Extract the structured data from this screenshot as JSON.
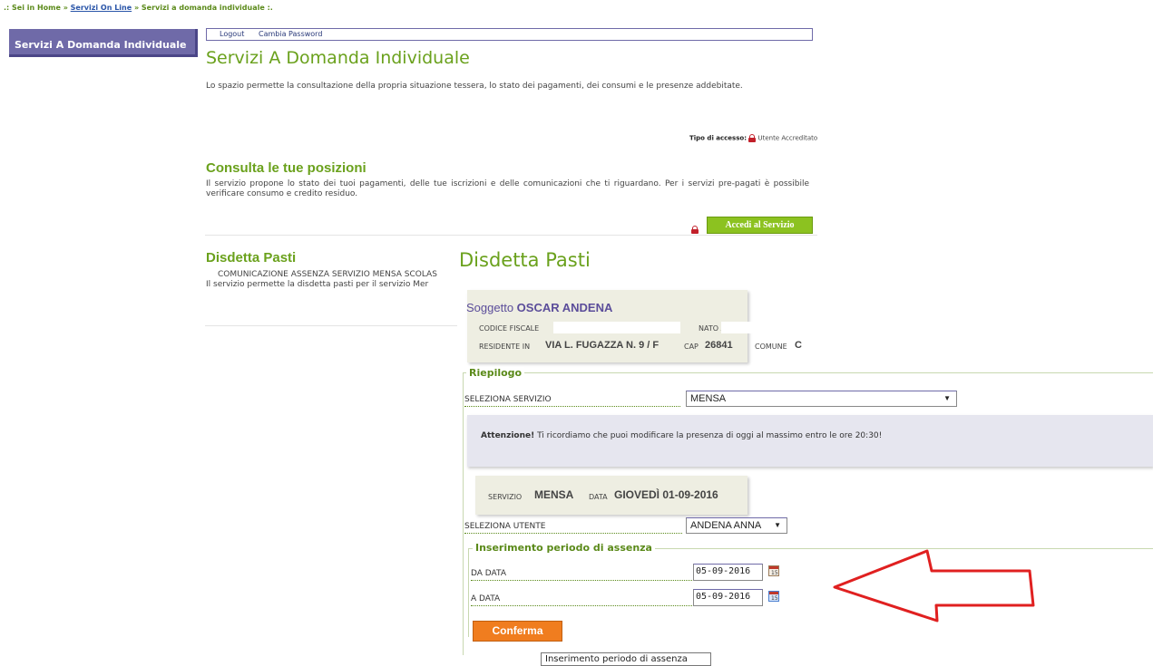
{
  "breadcrumb": {
    "prefix": ".: Sei in Home » ",
    "link": "Servizi On Line",
    "suffix": " » Servizi a domanda individuale :."
  },
  "sidebar": {
    "items": [
      {
        "label": "Servizi A Domanda Individuale"
      }
    ]
  },
  "toplinks": {
    "logout": "Logout",
    "cambia_password": "Cambia Password"
  },
  "main": {
    "title": "Servizi A Domanda Individuale",
    "intro": "Lo spazio permette la consultazione della propria situazione tessera, lo stato dei pagamenti, dei consumi e le presenze addebitate.",
    "tipo_accesso_label": "Tipo di accesso:",
    "tipo_accesso_value": "Utente Accreditato",
    "sections": [
      {
        "title": "Consulta le tue posizioni",
        "text": "Il servizio propone lo stato dei tuoi pagamenti, delle tue iscrizioni e delle comunicazioni che ti riguardano. Per i servizi pre-pagati è possibile verificare consumo e credito residuo.",
        "button": "Accedi al Servizio"
      },
      {
        "title": "Disdetta Pasti",
        "line1": "COMUNICAZIONE ASSENZA SERVIZIO MENSA SCOLAS",
        "line2": "Il servizio permette la disdetta pasti per il servizio Mer"
      }
    ]
  },
  "overlay": {
    "title": "Disdetta Pasti",
    "soggetto": {
      "label": "Soggetto",
      "name": "OSCAR ANDENA",
      "codice_fiscale_label": "CODICE FISCALE",
      "nato_a_label": "NATO A",
      "residente_label": "RESIDENTE IN",
      "residente_value": "VIA L. FUGAZZA N. 9 / F",
      "cap_label": "CAP",
      "cap_value": "26841",
      "comune_label": "COMUNE",
      "comune_value": "C"
    },
    "riepilogo": {
      "legend": "Riepilogo",
      "seleziona_servizio_label": "SELEZIONA SERVIZIO",
      "servizio_selected": "MENSA",
      "attenzione_bold": "Attenzione!",
      "attenzione_text": " Ti ricordiamo che puoi modificare la presenza di oggi al massimo entro le ore 20:30!",
      "servizio_label": "SERVIZIO",
      "servizio_value": "MENSA",
      "data_label": "DATA",
      "data_value": "GIOVEDÌ 01-09-2016",
      "seleziona_utente_label": "SELEZIONA UTENTE",
      "utente_selected": "ANDENA ANNA"
    },
    "assenza": {
      "legend": "Inserimento periodo di assenza",
      "da_data_label": "DA DATA",
      "da_data_value": "05-09-2016",
      "a_data_label": "A DATA",
      "a_data_value": "05-09-2016",
      "conferma": "Conferma",
      "tooltip": "Inserimento periodo di assenza"
    }
  },
  "colors": {
    "green": "#6aa11c",
    "purple": "#6f6aa8",
    "orange": "#f07d1f",
    "arrow_red": "#e02020",
    "button_green": "#8cc220"
  },
  "icons": {
    "lock": "lock-icon",
    "calendar": "calendar-icon",
    "dropdown": "chevron-down-icon",
    "arrow": "left-arrow-annotation"
  }
}
